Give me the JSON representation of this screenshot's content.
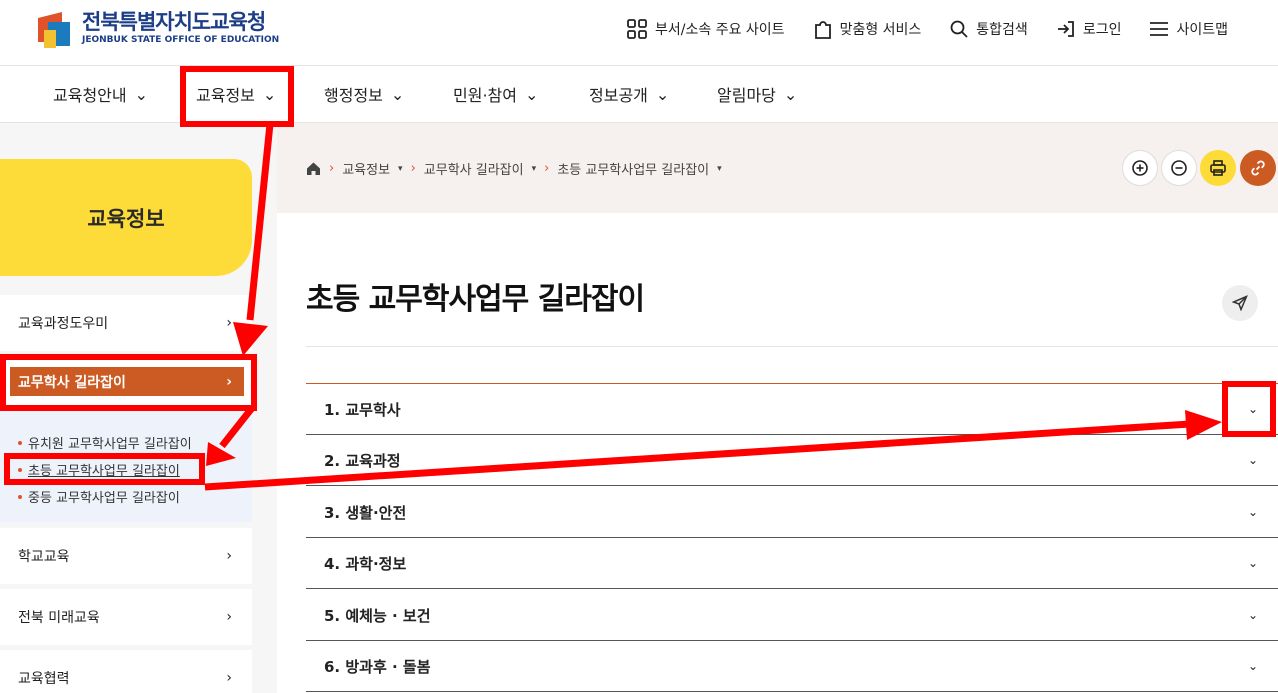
{
  "header": {
    "logo_ko": "전북특별자치도교육청",
    "logo_en": "JEONBUK STATE OFFICE OF EDUCATION",
    "utils": [
      {
        "label": "부서/소속 주요 사이트",
        "icon": "grid-icon"
      },
      {
        "label": "맞춤형 서비스",
        "icon": "puzzle-icon"
      },
      {
        "label": "통합검색",
        "icon": "search-icon"
      },
      {
        "label": "로그인",
        "icon": "login-icon"
      },
      {
        "label": "사이트맵",
        "icon": "menu-icon"
      }
    ]
  },
  "gnb": [
    "교육청안내",
    "교육정보",
    "행정정보",
    "민원·참여",
    "정보공개",
    "알림마당"
  ],
  "sidebar": {
    "title": "교육정보",
    "items": [
      "교육과정도우미",
      "교무학사 길라잡이",
      "학교교육",
      "전북 미래교육",
      "교육협력"
    ],
    "sub_items": [
      "유치원 교무학사업무 길라잡이",
      "초등 교무학사업무 길라잡이",
      "중등 교무학사업무 길라잡이"
    ],
    "chevron": "›"
  },
  "breadcrumb": [
    "교육정보",
    "교무학사 길라잡이",
    "초등 교무학사업무 길라잡이"
  ],
  "page": {
    "title": "초등 교무학사업무 길라잡이"
  },
  "accordion": [
    "1. 교무학사",
    "2. 교육과정",
    "3. 생활·안전",
    "4. 과학·정보",
    "5. 예체능 · 보건",
    "6. 방과후 · 돌봄"
  ],
  "colors": {
    "accent": "#cb5b22",
    "yellow": "#fddb38",
    "annotation": "#ff0000"
  }
}
